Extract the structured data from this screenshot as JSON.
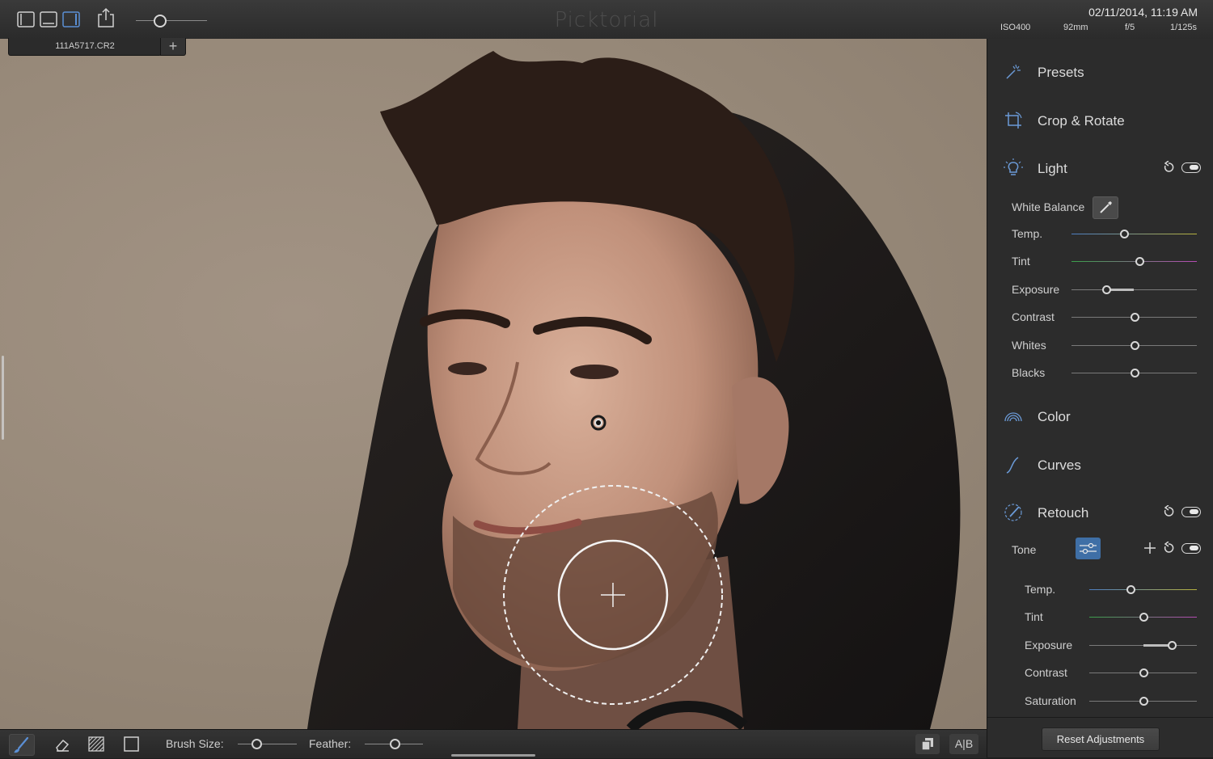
{
  "app": {
    "title": "Picktorial",
    "datetime": "02/11/2014, 11:19 AM",
    "exif": {
      "iso": "ISO400",
      "focal": "92mm",
      "aperture": "f/5",
      "shutter": "1/125s"
    },
    "zoom_level": 0.35
  },
  "tabs": [
    {
      "label": "111A5717.CR2"
    }
  ],
  "panel": {
    "presets": "Presets",
    "crop": "Crop & Rotate",
    "light": {
      "label": "Light",
      "white_balance": "White Balance",
      "sliders": [
        {
          "label": "Temp.",
          "value": 0.42
        },
        {
          "label": "Tint",
          "value": 0.54
        },
        {
          "label": "Exposure",
          "value": 0.28
        },
        {
          "label": "Contrast",
          "value": 0.5
        },
        {
          "label": "Whites",
          "value": 0.5
        },
        {
          "label": "Blacks",
          "value": 0.5
        }
      ]
    },
    "color": "Color",
    "curves": "Curves",
    "retouch": {
      "label": "Retouch",
      "tone": "Tone",
      "sliders": [
        {
          "label": "Temp.",
          "value": 0.38
        },
        {
          "label": "Tint",
          "value": 0.5
        },
        {
          "label": "Exposure",
          "value": 0.77
        },
        {
          "label": "Contrast",
          "value": 0.5
        },
        {
          "label": "Saturation",
          "value": 0.5
        }
      ]
    },
    "reset_button": "Reset Adjustments"
  },
  "bottom": {
    "brush_size_label": "Brush Size:",
    "brush_size": 0.3,
    "feather_label": "Feather:",
    "feather": 0.5,
    "ab_label": "A|B"
  }
}
